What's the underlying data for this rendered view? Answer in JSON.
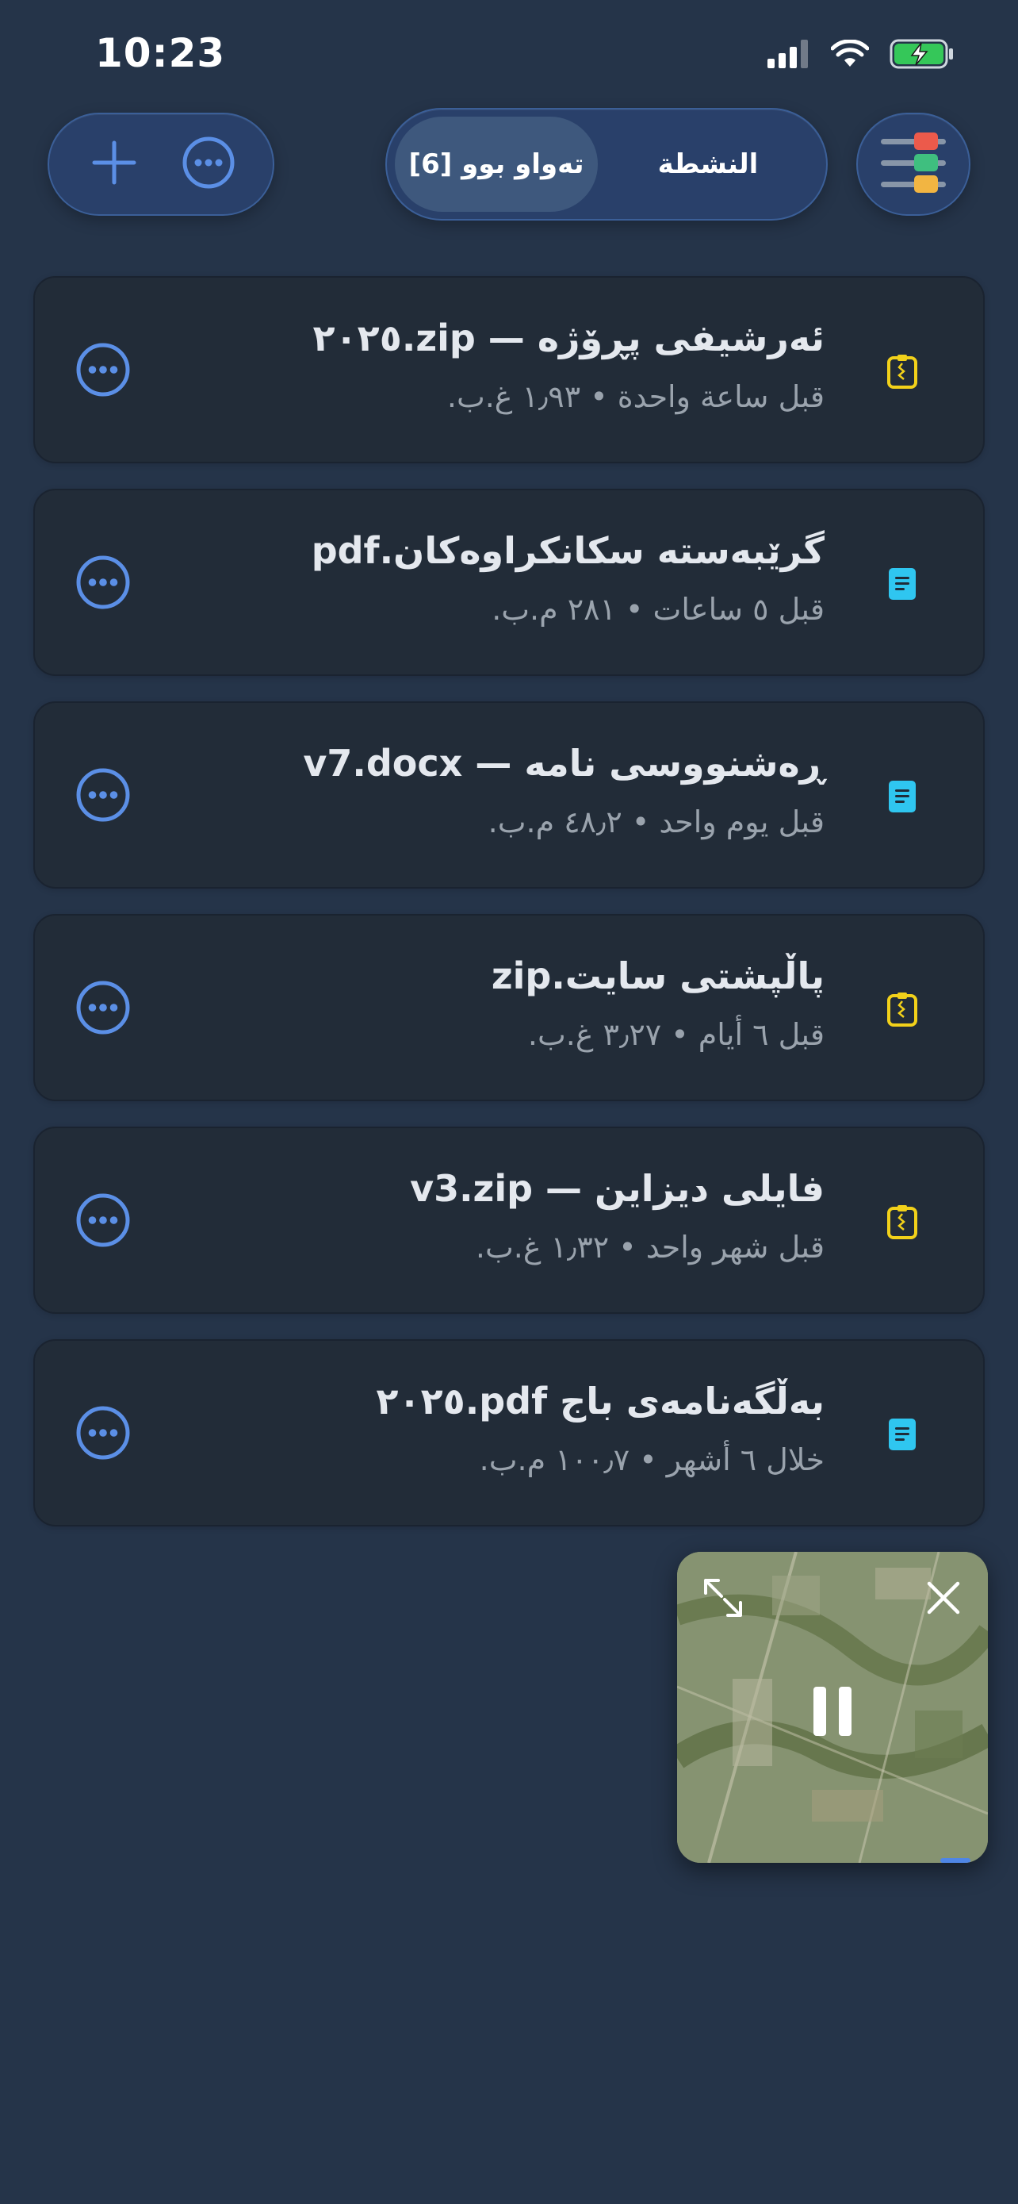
{
  "status_bar": {
    "time": "10:23",
    "icons": [
      "signal-icon",
      "wifi-icon",
      "battery-charging-icon"
    ]
  },
  "toolbar": {
    "left_group": {
      "icons": [
        "plus-icon",
        "more-circle-icon"
      ]
    },
    "segments": [
      {
        "label": "تەواو بوو [6]",
        "active": true
      },
      {
        "label": "النشطة",
        "active": false
      }
    ],
    "menu_icon": "colored-list-icon"
  },
  "files": [
    {
      "title": "ئەرشیفی پڕۆژە — zip.٢٠٢٥",
      "meta": "قبل ساعة واحدة • ١٫٩٣ غ.ب.",
      "type_icon": "zip-file-icon",
      "type_color": "#f2d11a"
    },
    {
      "title": "گرێبەستە سکانکراوەکان.pdf",
      "meta": "قبل ٥ ساعات • ٢٨١ م.ب.",
      "type_icon": "document-file-icon",
      "type_color": "#2fc6f0"
    },
    {
      "title": "ڕەشنووسی نامە — v7.docx",
      "meta": "قبل يوم واحد • ٤٨٫٢ م.ب.",
      "type_icon": "document-file-icon",
      "type_color": "#2fc6f0"
    },
    {
      "title": "پاڵپشتی سایت.zip",
      "meta": "قبل ٦ أيام • ٣٫٢٧ غ.ب.",
      "type_icon": "zip-file-icon",
      "type_color": "#f2d11a"
    },
    {
      "title": "فایلی دیزاین — v3.zip",
      "meta": "قبل شهر واحد • ١٫٣٢ غ.ب.",
      "type_icon": "zip-file-icon",
      "type_color": "#f2d11a"
    },
    {
      "title": "بەڵگەنامەی باج pdf.٢٠٢٥",
      "meta": "خلال ٦ أشهر • ١٠٠٫٧ م.ب.",
      "type_icon": "document-file-icon",
      "type_color": "#2fc6f0"
    }
  ],
  "pip": {
    "icons": [
      "expand-icon",
      "close-icon",
      "pause-icon"
    ],
    "progress_fraction": 0.03
  },
  "colors": {
    "background": "#253449",
    "card": "#222c38",
    "accent_blue": "#5b8fe6"
  }
}
